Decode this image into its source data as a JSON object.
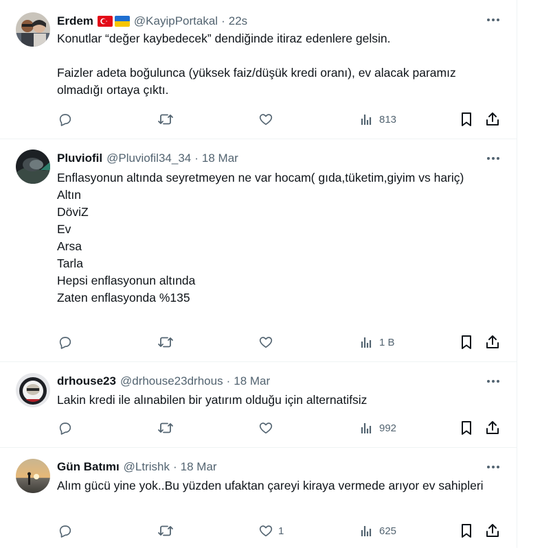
{
  "tweets": [
    {
      "name": "Erdem",
      "flags": [
        "turkey-flag",
        "ukraine-flag"
      ],
      "handle": "@KayipPortakal",
      "dot": "·",
      "time": "22s",
      "text": "Konutlar “değer kaybedecek” dendiğinde itiraz edenlere gelsin.\n\nFaizler adeta boğulunca (yüksek faiz/düşük kredi oranı), ev alacak paramız olmadığı ortaya çıktı.",
      "likes": "",
      "views": "813"
    },
    {
      "name": "Pluviofil",
      "handle": "@Pluviofil34_34",
      "dot": "·",
      "time": "18 Mar",
      "text": "Enflasyonun altında seyretmeyen ne var hocam( gıda,tüketim,giyim vs hariç)\nAltın\nDöviZ\nEv\nArsa\nTarla\nHepsi enflasyonun altında\nZaten enflasyonda %135",
      "likes": "",
      "views": "1 B"
    },
    {
      "name": "drhouse23",
      "handle": "@drhouse23drhous",
      "dot": "·",
      "time": "18 Mar",
      "text": "Lakin kredi ile alınabilen bir yatırım olduğu için alternatifsiz",
      "likes": "",
      "views": "992"
    },
    {
      "name": "Gün Batımı",
      "handle": "@Ltrishk",
      "dot": "·",
      "time": "18 Mar",
      "text": "Alım gücü yine yok..Bu yüzden ufaktan çareyi kiraya vermede arıyor ev sahipleri",
      "likes": "1",
      "views": "625"
    }
  ],
  "colors": {
    "text": "#0f1419",
    "secondary": "#536471",
    "divider": "#eff3f4"
  }
}
